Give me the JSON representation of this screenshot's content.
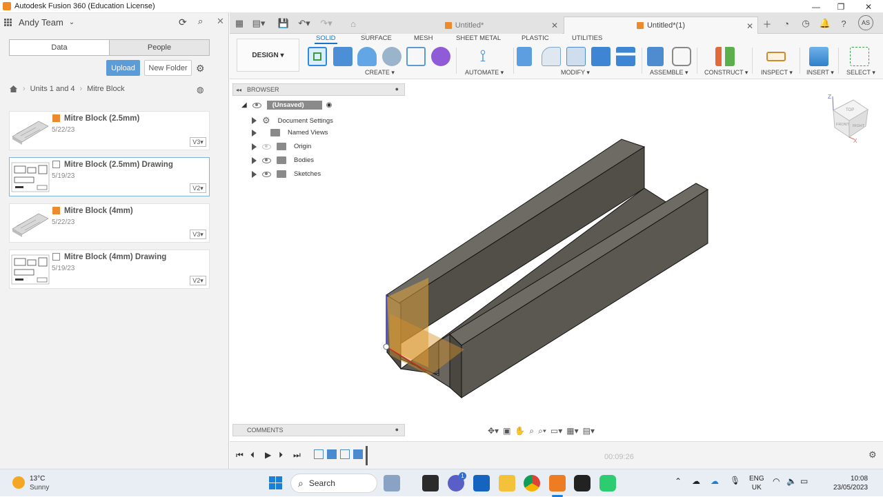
{
  "window": {
    "title": "Autodesk Fusion 360 (Education License)",
    "minimize": "—",
    "maximize": "❐",
    "close": "✕"
  },
  "left_panel": {
    "team": "Andy Team",
    "tabs": [
      "Data",
      "People"
    ],
    "upload": "Upload",
    "new_folder": "New Folder",
    "breadcrumb": [
      "Units 1 and 4",
      "Mitre Block"
    ],
    "files": [
      {
        "name": "Mitre Block (2.5mm)",
        "date": "5/22/23",
        "version": "V3",
        "kind": "design"
      },
      {
        "name": "Mitre Block (2.5mm) Drawing",
        "date": "5/19/23",
        "version": "V2",
        "kind": "drawing"
      },
      {
        "name": "Mitre Block (4mm)",
        "date": "5/22/23",
        "version": "V3",
        "kind": "design"
      },
      {
        "name": "Mitre Block (4mm) Drawing",
        "date": "5/19/23",
        "version": "V2",
        "kind": "drawing"
      }
    ]
  },
  "doc_tabs": [
    {
      "label": "Untitled*",
      "active": false
    },
    {
      "label": "Untitled*(1)",
      "active": true
    }
  ],
  "user_initials": "AS",
  "toolbar": {
    "workspace": "DESIGN",
    "ws_tabs": [
      "SOLID",
      "SURFACE",
      "MESH",
      "SHEET METAL",
      "PLASTIC",
      "UTILITIES"
    ],
    "groups": [
      "CREATE",
      "AUTOMATE",
      "MODIFY",
      "ASSEMBLE",
      "CONSTRUCT",
      "INSPECT",
      "INSERT",
      "SELECT"
    ]
  },
  "browser": {
    "title": "BROWSER",
    "root": "(Unsaved)",
    "items": [
      "Document Settings",
      "Named Views",
      "Origin",
      "Bodies",
      "Sketches"
    ]
  },
  "comments": "COMMENTS",
  "viewcube": {
    "top": "TOP",
    "front": "FRONT",
    "right": "RIGHT",
    "z": "Z",
    "x": "X"
  },
  "timeline": {
    "time": "00:09:26"
  },
  "taskbar": {
    "weather_temp": "13°C",
    "weather_desc": "Sunny",
    "search": "Search",
    "lang1": "ENG",
    "lang2": "UK",
    "time": "10:08",
    "date": "23/05/2023",
    "teams_badge": "1"
  },
  "colors": {
    "accent": "#1a73c8",
    "upload": "#5a9bd8",
    "body": "#5a5750",
    "fusion_orange": "#ee8a2e"
  }
}
